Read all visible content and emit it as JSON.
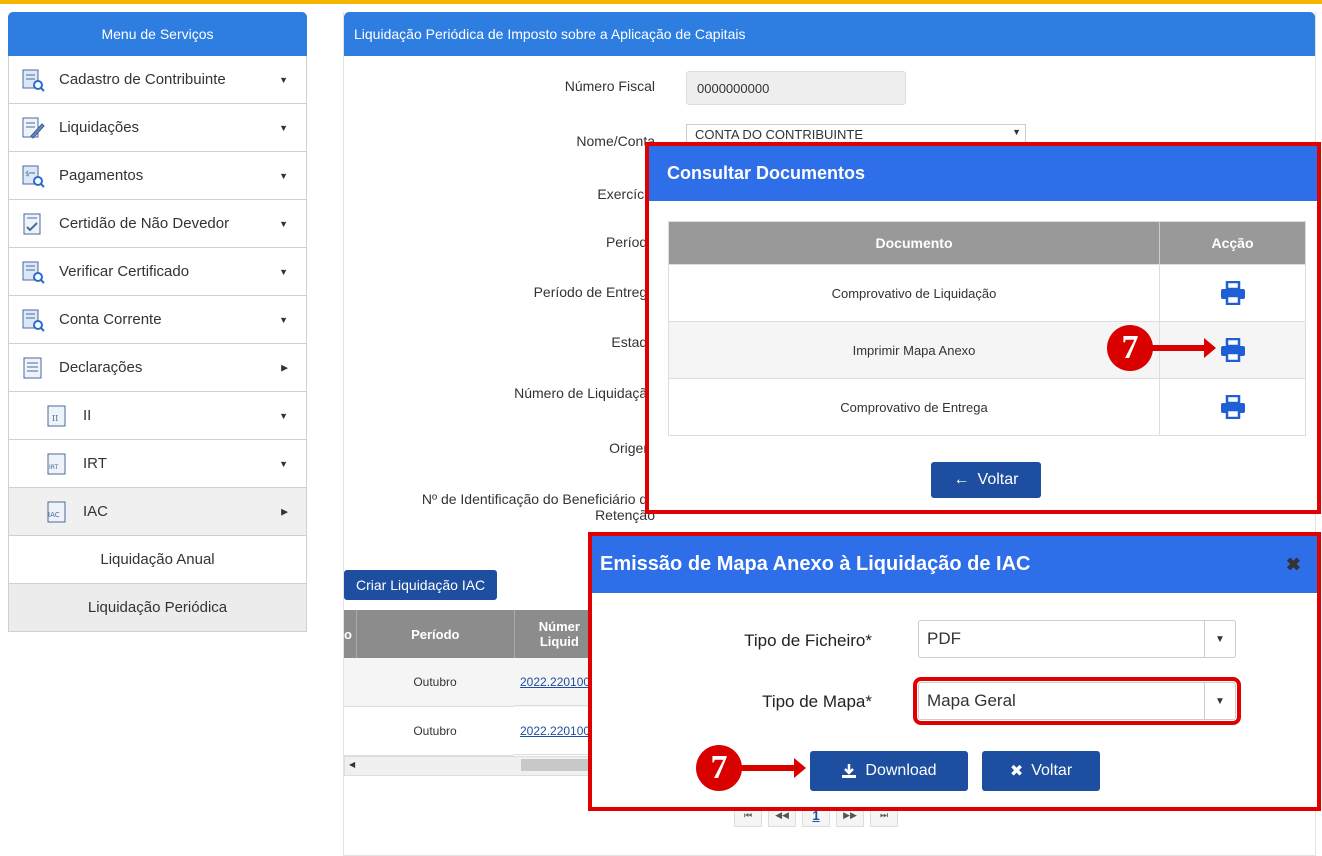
{
  "sidebar": {
    "title": "Menu de Serviços",
    "items": [
      {
        "label": "Cadastro de Contribuinte",
        "caret": "▼"
      },
      {
        "label": "Liquidações",
        "caret": "▼"
      },
      {
        "label": "Pagamentos",
        "caret": "▼"
      },
      {
        "label": "Certidão de Não Devedor",
        "caret": "▼"
      },
      {
        "label": "Verificar Certificado",
        "caret": "▼"
      },
      {
        "label": "Conta Corrente",
        "caret": "▼"
      },
      {
        "label": "Declarações",
        "caret": "▶"
      }
    ],
    "sub_items": [
      {
        "label": "II",
        "icon_text": "II",
        "caret": "▼"
      },
      {
        "label": "IRT",
        "icon_text": "IRT",
        "caret": "▼"
      },
      {
        "label": "IAC",
        "icon_text": "IAC",
        "caret": "▶"
      }
    ],
    "leaf_items": [
      "Liquidação Anual",
      "Liquidação Periódica"
    ]
  },
  "main": {
    "title": "Liquidação Periódica de Imposto sobre a Aplicação de Capitais",
    "fields": {
      "numero_fiscal_label": "Número Fiscal",
      "numero_fiscal_value": "0000000000",
      "nome_conta_label": "Nome/Conta",
      "nome_conta_value": "CONTA DO CONTRIBUINTE",
      "exercicio_label": "Exercício",
      "periodo_label": "Período",
      "periodo_entrega_label": "Período de Entrega",
      "estado_label": "Estado",
      "numero_liquidacao_label": "Número de Liquidação",
      "origem_label": "Origem",
      "beneficiario_label_1": "Nº de Identificação do Beneficiário da",
      "beneficiario_label_2": "Retenção"
    },
    "criar_button": "Criar Liquidação IAC",
    "table": {
      "col0": "o",
      "col_periodo": "Período",
      "col_numero_1": "Númer",
      "col_numero_2": "Liquid",
      "rows": [
        {
          "periodo": "Outubro",
          "numero": "2022.220100"
        },
        {
          "periodo": "Outubro",
          "numero": "2022.220100"
        }
      ]
    },
    "pager": {
      "first": "⏮",
      "prev": "◀◀",
      "page": "1",
      "next": "▶▶",
      "last": "⏭"
    }
  },
  "consultar": {
    "title": "Consultar Documentos",
    "col_documento": "Documento",
    "col_accao": "Acção",
    "rows": [
      "Comprovativo de Liquidação",
      "Imprimir Mapa Anexo",
      "Comprovativo de Entrega"
    ],
    "voltar": "Voltar",
    "voltar_icon": "←"
  },
  "emissao": {
    "title": "Emissão de Mapa Anexo à Liquidação de IAC",
    "close": "✖",
    "tipo_ficheiro_label": "Tipo de Ficheiro*",
    "tipo_ficheiro_value": "PDF",
    "tipo_mapa_label": "Tipo de Mapa*",
    "tipo_mapa_value": "Mapa Geral",
    "download": "Download",
    "voltar": "Voltar",
    "voltar_icon": "✖"
  },
  "annotations": {
    "step1": "7",
    "step2": "7"
  },
  "colors": {
    "header_blue": "#2e7de1",
    "button_blue": "#1e4e9f",
    "highlight_red": "#e00000",
    "top_bar": "#f5b400"
  }
}
